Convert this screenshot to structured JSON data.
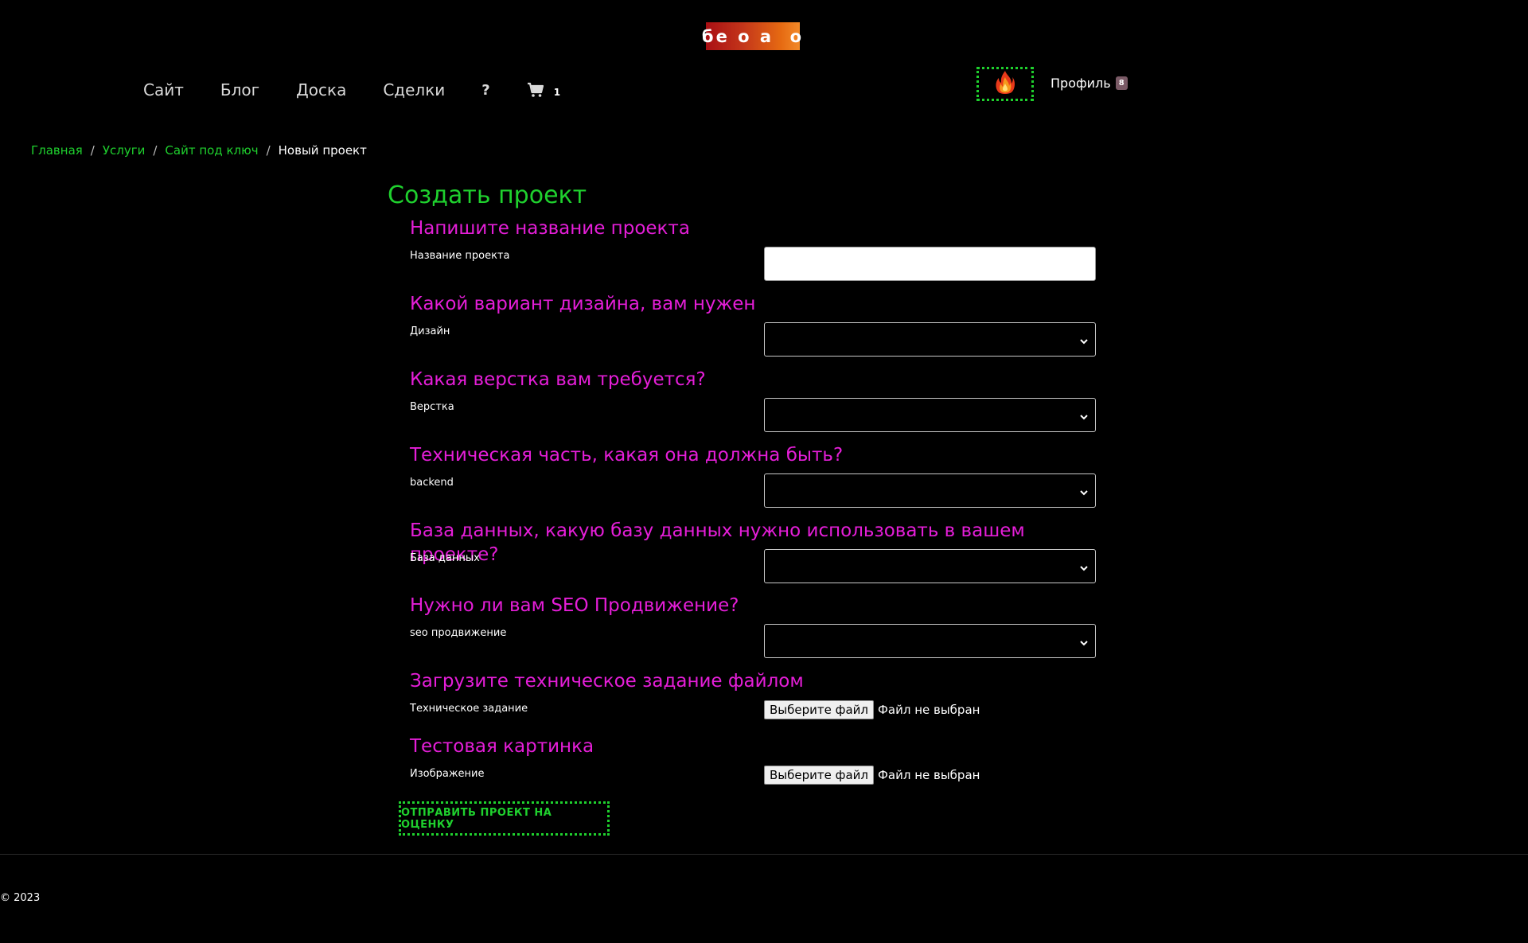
{
  "logo": {
    "text": "бе о а  о"
  },
  "nav": {
    "items": [
      "Сайт",
      "Блог",
      "Доска",
      "Сделки"
    ],
    "help": "?",
    "cart_count": "1"
  },
  "profile": {
    "label": "Профиль",
    "badge": "8"
  },
  "breadcrumb": {
    "items": [
      "Главная",
      "Услуги",
      "Сайт под ключ"
    ],
    "separator": "/",
    "current": "Новый проект"
  },
  "page_title": "Создать проект",
  "form": {
    "sections": [
      {
        "heading": "Напишите название проекта",
        "label": "Название проекта",
        "type": "text",
        "value": ""
      },
      {
        "heading": "Какой вариант дизайна, вам нужен",
        "label": "Дизайн",
        "type": "select",
        "value": ""
      },
      {
        "heading": "Какая верстка вам требуется?",
        "label": "Верстка",
        "type": "select",
        "value": ""
      },
      {
        "heading": "Техническая часть, какая она должна быть?",
        "label": "backend",
        "type": "select",
        "value": ""
      },
      {
        "heading": "База данных, какую базу данных нужно использовать в вашем проекте?",
        "label": "База данных",
        "type": "select",
        "value": ""
      },
      {
        "heading": "Нужно ли вам SEO Продвижение?",
        "label": "seo продвижение",
        "type": "select",
        "value": ""
      },
      {
        "heading": "Загрузите техническое задание файлом",
        "label": "Техническое задание",
        "type": "file",
        "button": "Выберите файл",
        "status": "Файл не выбран"
      },
      {
        "heading": "Тестовая картинка",
        "label": "Изображение",
        "type": "file",
        "button": "Выберите файл",
        "status": "Файл не выбран"
      }
    ],
    "submit": "ОТПРАВИТЬ ПРОЕКТ НА ОЦЕНКУ"
  },
  "footer": {
    "copyright": "© 2023"
  },
  "colors": {
    "accent_green": "#1fd12e",
    "heading_magenta": "#e51ed8",
    "background": "#000000"
  },
  "icons": [
    "cart-icon",
    "fire-icon",
    "chevron-down-icon"
  ]
}
